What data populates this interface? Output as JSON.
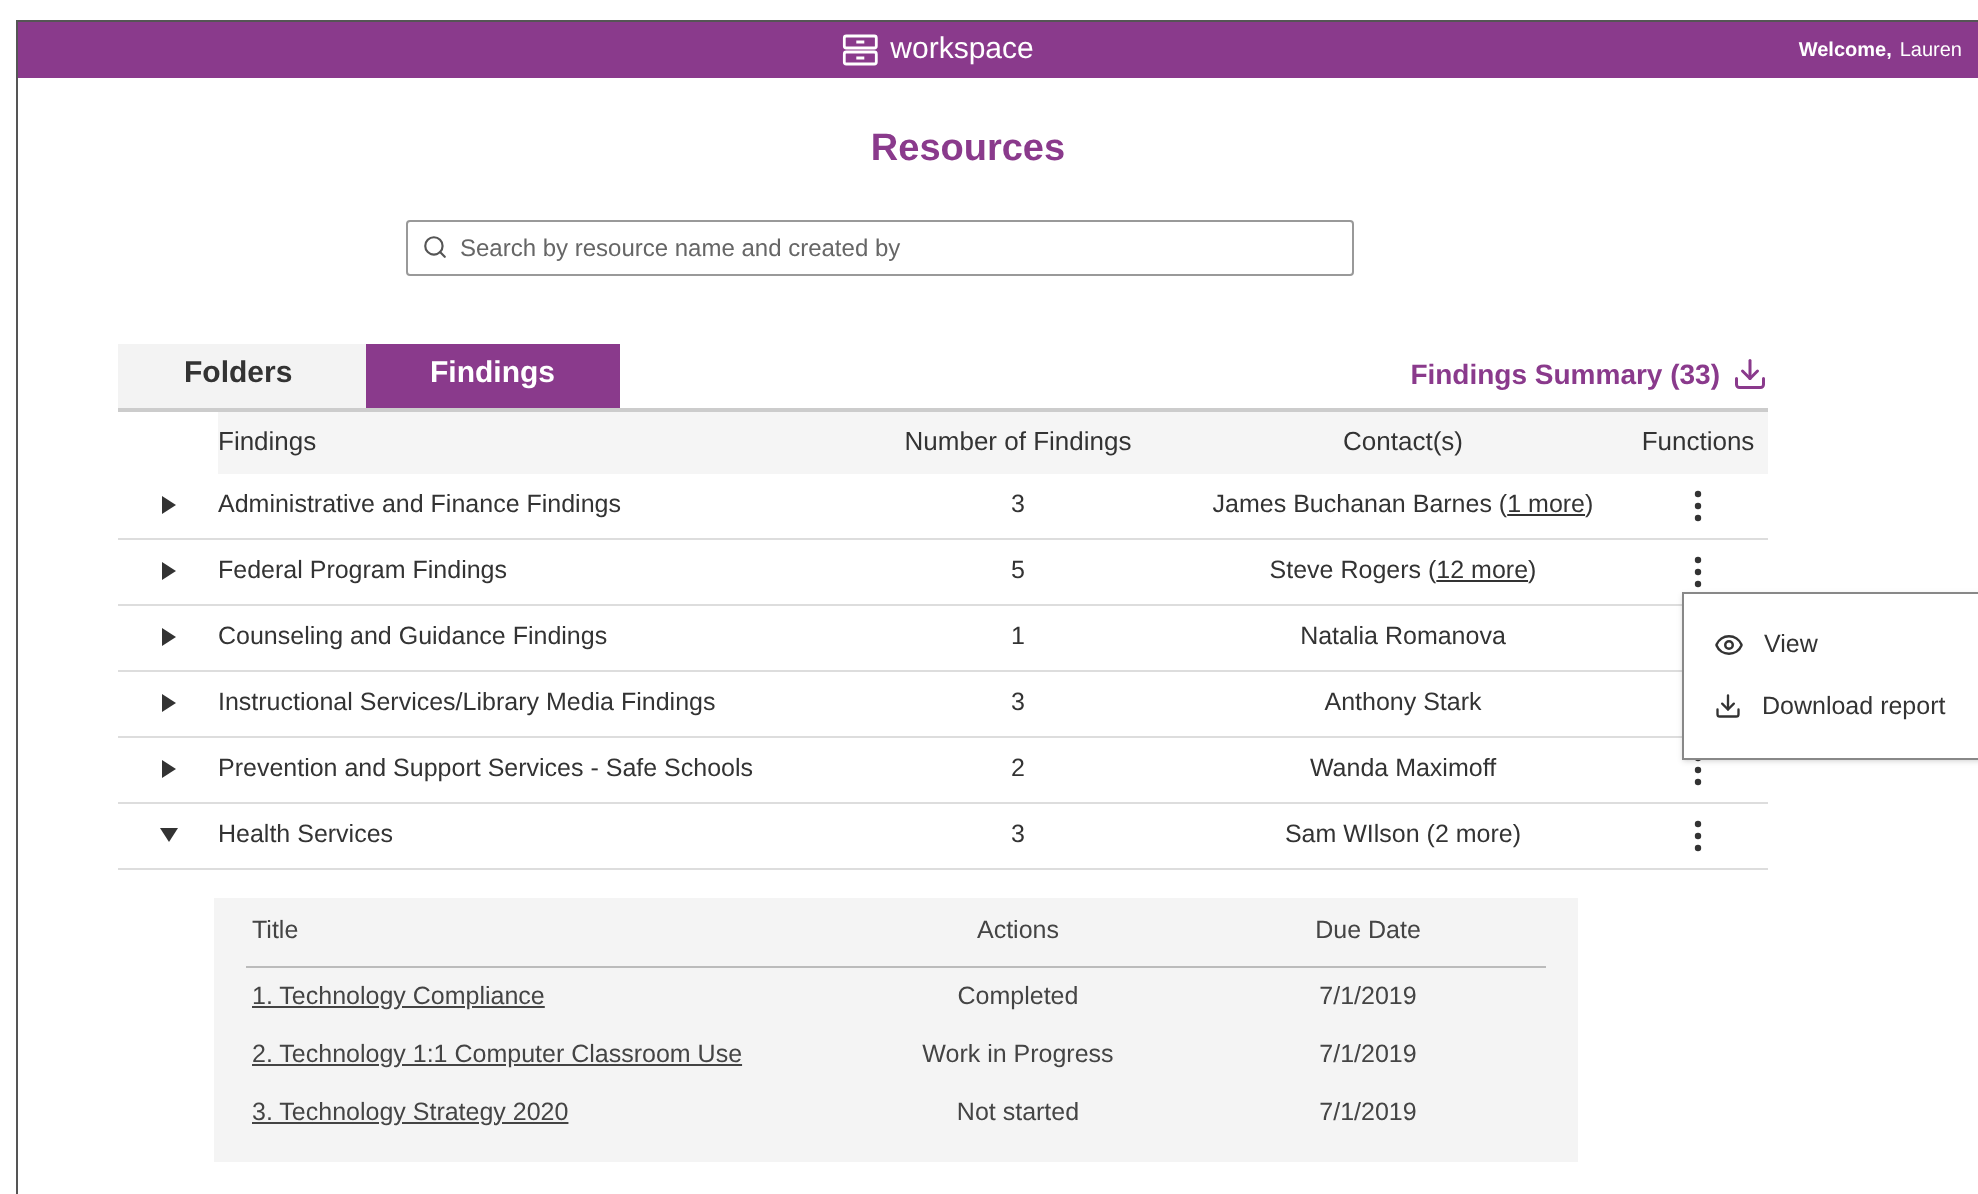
{
  "header": {
    "brand": "workspace",
    "welcome": "Welcome,",
    "user": "Lauren"
  },
  "page_title": "Resources",
  "search": {
    "placeholder": "Search by resource name and created by"
  },
  "tabs": [
    {
      "label": "Folders",
      "selected": false
    },
    {
      "label": "Findings",
      "selected": true
    }
  ],
  "summary_link": "Findings Summary (33)",
  "table": {
    "columns": [
      "Findings",
      "Number of Findings",
      "Contact(s)",
      "Functions"
    ],
    "rows": [
      {
        "name": "Administrative and Finance Findings",
        "count": "3",
        "contact": "James Buchanan Barnes (",
        "more_link": "1 more",
        "contact_end": ")",
        "expanded": false
      },
      {
        "name": "Federal Program Findings",
        "count": "5",
        "contact": "Steve Rogers (",
        "more_link": "12 more",
        "contact_end": ")",
        "expanded": false
      },
      {
        "name": "Counseling and Guidance Findings",
        "count": "1",
        "contact": "Natalia Romanova",
        "expanded": false
      },
      {
        "name": "Instructional Services/Library Media Findings",
        "count": "3",
        "contact": "Anthony Stark",
        "expanded": false
      },
      {
        "name": "Prevention and Support Services - Safe Schools",
        "count": "2",
        "contact": "Wanda Maximoff",
        "expanded": false
      },
      {
        "name": "Health Services",
        "count": "3",
        "contact": "Sam WIlson (2 more)",
        "expanded": true
      }
    ]
  },
  "subtable": {
    "columns": [
      "Title",
      "Actions",
      "Due Date"
    ],
    "rows": [
      {
        "title": "1. Technology Compliance",
        "action": "Completed",
        "due": "7/1/2019"
      },
      {
        "title": "2. Technology 1:1 Computer Classroom Use",
        "action": "Work in Progress",
        "due": "7/1/2019"
      },
      {
        "title": "3. Technology Strategy 2020",
        "action": "Not started",
        "due": "7/1/2019"
      }
    ]
  },
  "menu": [
    {
      "kind": "view",
      "label": "View"
    },
    {
      "kind": "download",
      "label": "Download report"
    }
  ]
}
